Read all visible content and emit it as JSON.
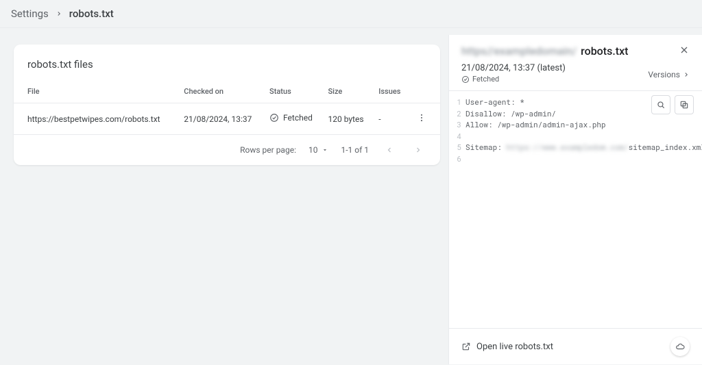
{
  "breadcrumb": {
    "parent": "Settings",
    "current": "robots.txt"
  },
  "card": {
    "title": "robots.txt files",
    "columns": {
      "file": "File",
      "checked": "Checked on",
      "status": "Status",
      "size": "Size",
      "issues": "Issues"
    },
    "row": {
      "file": "https://bestpetwipes.com/robots.txt",
      "checked": "21/08/2024, 13:37",
      "status": "Fetched",
      "size": "120 bytes",
      "issues": "-"
    },
    "pagination": {
      "rows_label": "Rows per page:",
      "rows_value": "10",
      "range": "1-1 of 1"
    }
  },
  "detail": {
    "title_suffix": "robots.txt",
    "timestamp": "21/08/2024, 13:37 (latest)",
    "fetched_label": "Fetched",
    "versions_label": "Versions",
    "code": {
      "l1": "User-agent: *",
      "l2": "Disallow: /wp-admin/",
      "l3": "Allow: /wp-admin/admin-ajax.php",
      "l4": "",
      "l5a": "Sitemap:",
      "l5b": "sitemap_index.xml",
      "l6": ""
    },
    "open_live": "Open live robots.txt"
  }
}
